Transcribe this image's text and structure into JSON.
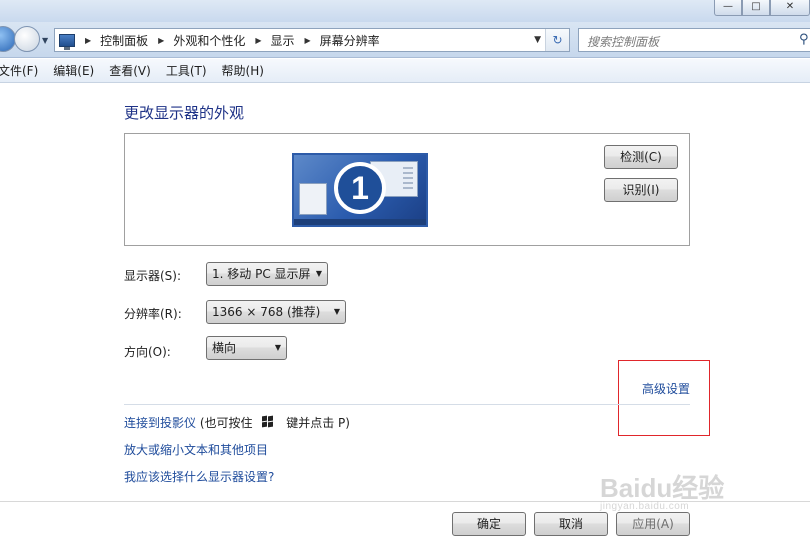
{
  "window": {
    "minimize": "—",
    "maximize": "□",
    "close": "✕"
  },
  "address_bar": {
    "crumbs": [
      "控制面板",
      "外观和个性化",
      "显示",
      "屏幕分辨率"
    ],
    "refresh_glyph": "↻"
  },
  "search": {
    "placeholder": "搜索控制面板"
  },
  "menu": [
    "文件(F)",
    "编辑(E)",
    "查看(V)",
    "工具(T)",
    "帮助(H)"
  ],
  "main": {
    "title": "更改显示器的外观",
    "monitor_number": "1",
    "detect_button": "检测(C)",
    "identify_button": "识别(I)",
    "display_label": "显示器(S):",
    "display_value": "1. 移动 PC 显示屏",
    "resolution_label": "分辨率(R):",
    "resolution_value": "1366 × 768 (推荐)",
    "orientation_label": "方向(O):",
    "orientation_value": "横向",
    "advanced_link": "高级设置",
    "projector_link": "连接到投影仪",
    "projector_hint_prefix": "(也可按住",
    "projector_hint_suffix": "键并点击 P)",
    "text_size_link": "放大或缩小文本和其他项目",
    "which_settings_link": "我应该选择什么显示器设置?"
  },
  "footer": {
    "ok": "确定",
    "cancel": "取消",
    "apply": "应用(A)"
  },
  "watermark": {
    "brand": "Baidu经验",
    "url": "jingyan.baidu.com"
  },
  "colors": {
    "link": "#1e4b9b",
    "title": "#1e3287",
    "highlight_box": "#e0262b"
  }
}
